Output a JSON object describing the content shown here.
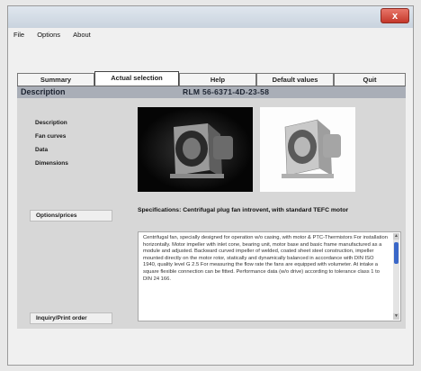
{
  "window": {
    "close_label": "x"
  },
  "menu": [
    "File",
    "Options",
    "About"
  ],
  "tabs": [
    {
      "label": "Summary",
      "active": false
    },
    {
      "label": "Actual selection",
      "active": true
    },
    {
      "label": "Help",
      "active": false
    },
    {
      "label": "Default values",
      "active": false
    },
    {
      "label": "Quit",
      "active": false
    }
  ],
  "header": {
    "section_title": "Description",
    "model_code": "RLM 56-6371-4D-23-58"
  },
  "sidebar": {
    "links": [
      "Description",
      "Fan curves",
      "Data",
      "Dimensions"
    ],
    "options_button": "Options/prices",
    "inquiry_button": "Inquiry/Print order"
  },
  "content": {
    "specifications": "Specifications: Centrifugal plug fan introvent, with standard TEFC motor",
    "description": "Centrifugal fan, specially designed for operation w/o casing, with motor & PTC-Thermistors For installation horizontally. Motor impeller with inlet cone, bearing unit, motor base and basic frame manufactured as a module and adjusted. Backward curved impeller of welded, coated sheet steel construction, impeller mounted directly on the motor rotor, statically and dynamically balanced in accordance with DIN ISO 1940, quality level G 2.5 For measuring the flow rate the fans are equipped with volumeter. At intake a square flexible connection can be fitted. Performance data (w/o drive) according to tolerance class 1 to DIN 24 166."
  },
  "colors": {
    "header_bar": "#a9aeb7",
    "panel": "#d7d7d7",
    "scroll_thumb": "#3a67c8"
  }
}
